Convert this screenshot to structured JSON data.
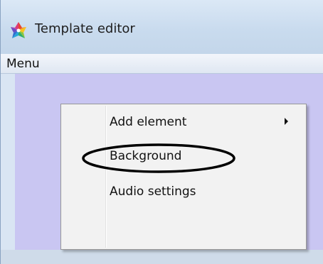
{
  "window": {
    "title": "Template editor"
  },
  "menubar": {
    "items": [
      {
        "label": "Menu"
      }
    ]
  },
  "context_menu": {
    "items": [
      {
        "label": "Add element",
        "has_submenu": true
      },
      {
        "label": "Background",
        "has_submenu": false,
        "highlighted": true
      },
      {
        "label": "Audio settings",
        "has_submenu": false
      }
    ]
  },
  "icons": {
    "app": "colorful-gear-icon",
    "submenu": "chevron-right-icon"
  },
  "colors": {
    "workspace": "#c9c6f2",
    "titlebar": "#c9dbee",
    "menu_background": "#f2f2f2",
    "highlight_ellipse": "#000000"
  }
}
